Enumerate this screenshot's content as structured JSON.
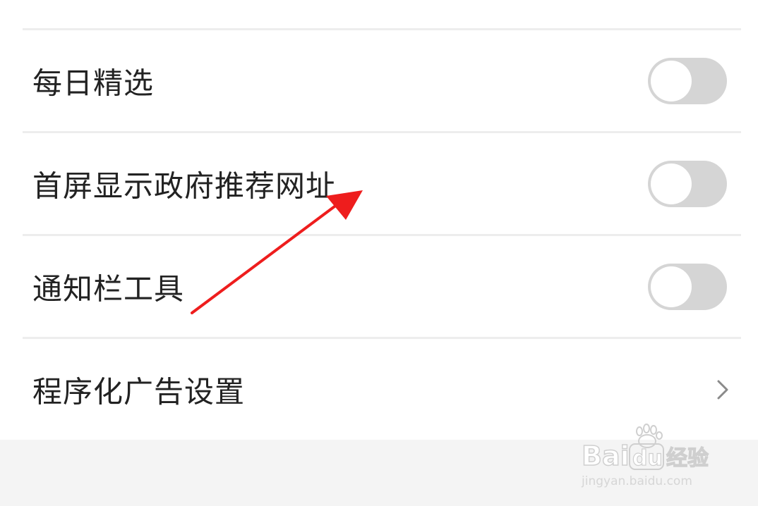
{
  "settings": {
    "items": [
      {
        "label": "每日精选",
        "control": "toggle",
        "on": false
      },
      {
        "label": "首屏显示政府推荐网址",
        "control": "toggle",
        "on": false
      },
      {
        "label": "通知栏工具",
        "control": "toggle",
        "on": false
      },
      {
        "label": "程序化广告设置",
        "control": "chevron-right-icon"
      }
    ]
  },
  "annotation": {
    "icon": "red-arrow-icon",
    "color": "#ee1d1d"
  },
  "colors": {
    "toggle_off": "#d5d5d5",
    "divider": "#ededed",
    "page_bg": "#f4f4f4",
    "text": "#222222"
  },
  "watermark": {
    "logo_text": "Baidu经验",
    "url": "jingyan.baidu.com"
  }
}
